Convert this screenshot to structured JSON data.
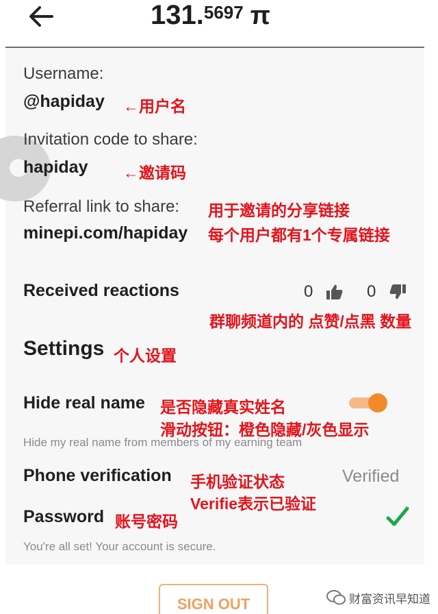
{
  "header": {
    "balance_int": "131.",
    "balance_dec": "5697",
    "currency": "π"
  },
  "profile": {
    "username_label": "Username:",
    "username_value": "@hapiday",
    "invite_label": "Invitation code to share:",
    "invite_value": "hapiday",
    "referral_label": "Referral link to share:",
    "referral_value": "minepi.com/hapiday"
  },
  "reactions": {
    "label": "Received reactions",
    "likes": "0",
    "dislikes": "0"
  },
  "settings": {
    "title": "Settings",
    "hide_name_label": "Hide real name",
    "hide_name_enabled": true,
    "hide_name_desc": "Hide my real name from members of my earning team",
    "phone_label": "Phone verification",
    "phone_status": "Verified",
    "password_label": "Password",
    "secure_msg": "You're all set! Your account is secure."
  },
  "signout_label": "SIGN OUT",
  "annotations": {
    "username": "←用户名",
    "invite": "←邀请码",
    "referral_1": "用于邀请的分享链接",
    "referral_2": "每个用户都有1个专属链接",
    "reactions": "群聊频道内的 点赞/点黑 数量",
    "settings": "个人设置",
    "hide_1": "是否隐藏真实姓名",
    "hide_2": "滑动按钮：橙色隐藏/灰色显示",
    "phone_1": "手机验证状态",
    "phone_2": "Verifie表示已验证",
    "password": "账号密码"
  },
  "watermark": "财富资讯早知道",
  "colors": {
    "accent_orange": "#f18a2a",
    "check_green": "#1aa84a",
    "annotation_red": "#e4131b"
  }
}
